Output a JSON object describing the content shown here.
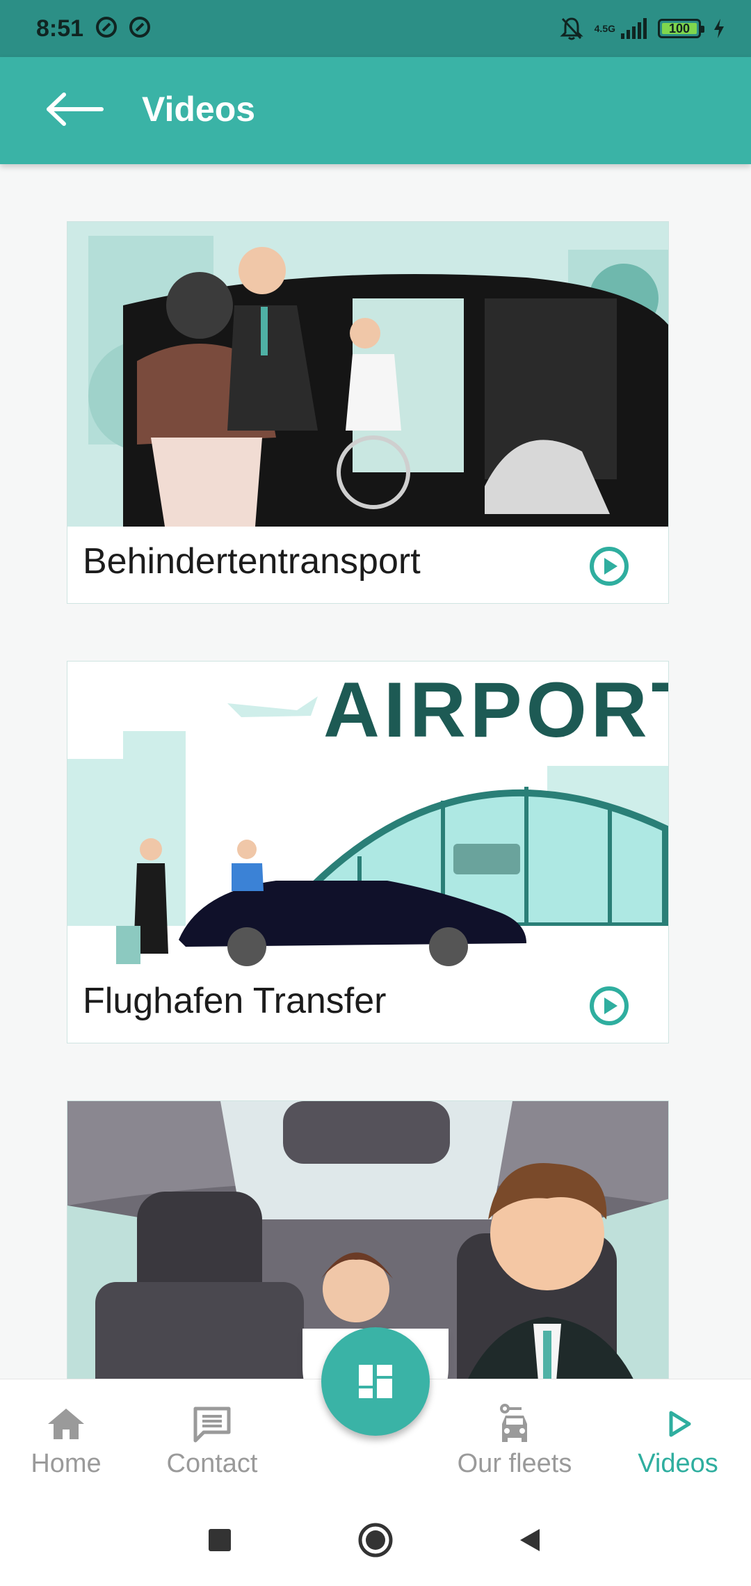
{
  "status_bar": {
    "time": "8:51",
    "network_label": "4.5G",
    "battery_level": "100"
  },
  "app_bar": {
    "title": "Videos",
    "back_icon": "arrow-left-icon"
  },
  "videos": [
    {
      "caption": "Behindertentransport",
      "icon": "play-circle-icon"
    },
    {
      "caption": "Flughafen Transfer",
      "icon": "play-circle-icon"
    },
    {
      "caption": "",
      "icon": "play-circle-icon"
    }
  ],
  "bottom_nav": {
    "items": [
      {
        "label": "Home",
        "icon": "home-icon"
      },
      {
        "label": "Contact",
        "icon": "message-icon"
      },
      {
        "label": "Our fleets",
        "icon": "car-icon"
      },
      {
        "label": "Videos",
        "icon": "play-icon",
        "active": true
      }
    ],
    "fab_icon": "dashboard-icon"
  },
  "colors": {
    "primary": "#3ab3a6",
    "status_bar": "#2c8f86",
    "inactive": "#9a9a9a",
    "active": "#2fae9f"
  }
}
